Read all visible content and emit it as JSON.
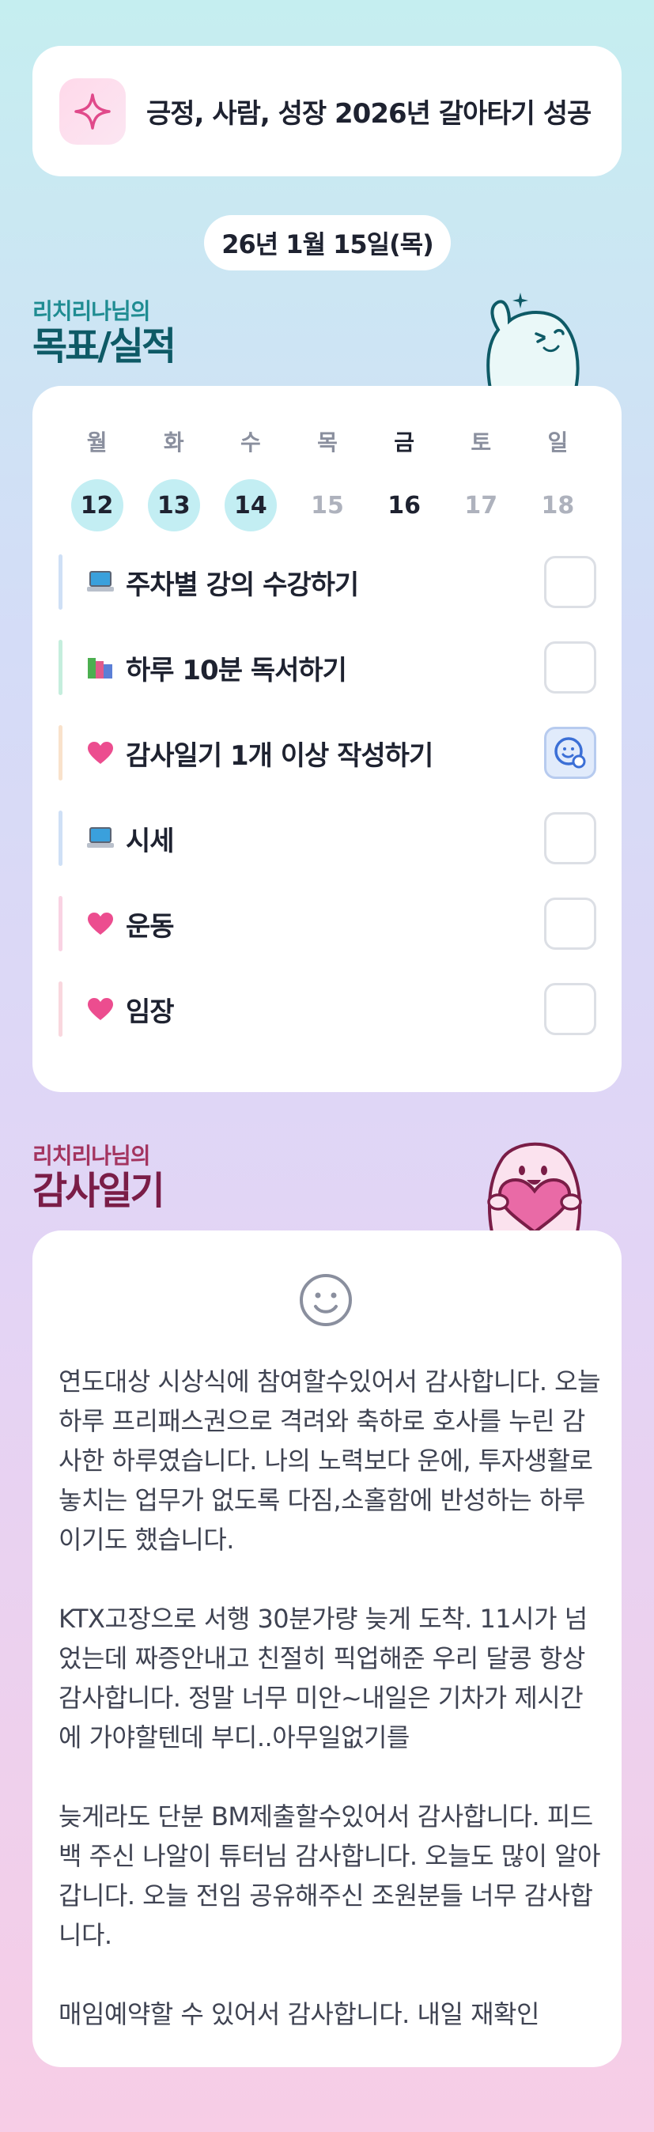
{
  "banner": {
    "title": "긍정, 사람, 성장 2026년 갈아타기 성공"
  },
  "date": "26년 1월 15일(목)",
  "goals_section": {
    "owner": "리치리나님의",
    "title": "목표/실적"
  },
  "week": [
    {
      "dow": "월",
      "day": "12",
      "state": "done"
    },
    {
      "dow": "화",
      "day": "13",
      "state": "done"
    },
    {
      "dow": "수",
      "day": "14",
      "state": "done"
    },
    {
      "dow": "목",
      "day": "15",
      "state": "future"
    },
    {
      "dow": "금",
      "day": "16",
      "state": "today"
    },
    {
      "dow": "토",
      "day": "17",
      "state": "future"
    },
    {
      "dow": "일",
      "day": "18",
      "state": "future"
    }
  ],
  "goals": [
    {
      "icon": "laptop-icon",
      "label": "주차별 강의 수강하기",
      "bar_color": "#cfe0f6",
      "checked": false
    },
    {
      "icon": "books-icon",
      "label": "하루 10분 독서하기",
      "bar_color": "#c5eedd",
      "checked": false
    },
    {
      "icon": "heart-icon",
      "label": "감사일기 1개 이상 작성하기",
      "bar_color": "#f9e2cb",
      "checked": true
    },
    {
      "icon": "laptop-icon",
      "label": "시세",
      "bar_color": "#cfe0f6",
      "checked": false
    },
    {
      "icon": "heart-icon",
      "label": "운동",
      "bar_color": "#f9d3e3",
      "checked": false
    },
    {
      "icon": "heart-icon",
      "label": "임장",
      "bar_color": "#f9d7de",
      "checked": false
    }
  ],
  "gratitude_section": {
    "owner": "리치리나님의",
    "title": "감사일기"
  },
  "gratitude": {
    "mood_icon": "smiley-icon",
    "paragraphs": [
      "연도대상 시상식에 참여할수있어서 감사합니다. 오늘하루 프리패스권으로 격려와 축하로 호사를 누린 감사한 하루였습니다. 나의 노력보다 운에, 투자생활로 놓치는 업무가 없도록 다짐,소홀함에 반성하는 하루이기도 했습니다.",
      "KTX고장으로 서행 30분가량 늦게 도착. 11시가 넘었는데  짜증안내고 친절히 픽업해준 우리  달콩 항상 감사합니다. 정말 너무 미안~내일은 기차가 제시간에 가야할텐데 부디..아무일없기를",
      "늦게라도 단분 BM제출할수있어서 감사합니다. 피드백 주신 나알이 튜터님 감사합니다. 오늘도 많이 알아갑니다. 오늘 전임 공유해주신 조원분들 너무 감사합니다.",
      "매임예약할 수 있어서 감사합니다. 내일  재확인"
    ]
  },
  "colors": {
    "accent_teal": "#0e5a66",
    "accent_plum": "#7a1d47",
    "check_blue": "#3b6fd6"
  }
}
